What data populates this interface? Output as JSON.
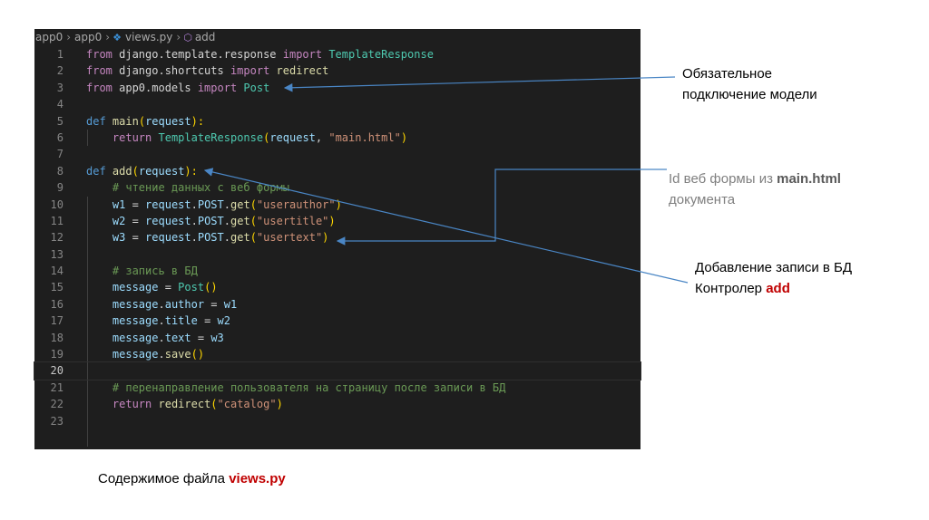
{
  "breadcrumb": {
    "items": [
      "app0",
      "app0",
      "views.py",
      "add"
    ],
    "icons": {
      "file": "python-file-icon",
      "symbol": "cube-method-icon"
    }
  },
  "code": {
    "active_line": 20,
    "lines": [
      {
        "n": "1"
      },
      {
        "n": "2"
      },
      {
        "n": "3"
      },
      {
        "n": "4"
      },
      {
        "n": "5"
      },
      {
        "n": "6"
      },
      {
        "n": "7"
      },
      {
        "n": "8"
      },
      {
        "n": "9"
      },
      {
        "n": "10"
      },
      {
        "n": "11"
      },
      {
        "n": "12"
      },
      {
        "n": "13"
      },
      {
        "n": "14"
      },
      {
        "n": "15"
      },
      {
        "n": "16"
      },
      {
        "n": "17"
      },
      {
        "n": "18"
      },
      {
        "n": "19"
      },
      {
        "n": "20"
      },
      {
        "n": "21"
      },
      {
        "n": "22"
      },
      {
        "n": "23"
      }
    ],
    "tokens": {
      "l1": [
        "from",
        " django.template.response ",
        "import",
        " TemplateResponse"
      ],
      "l2": [
        "from",
        " django.shortcuts ",
        "import",
        " redirect"
      ],
      "l3": [
        "from",
        " app0.models ",
        "import",
        " Post"
      ],
      "l5": [
        "def",
        " ",
        "main",
        "(",
        "request",
        "):"
      ],
      "l6": [
        "return",
        " ",
        "TemplateResponse",
        "(",
        "request",
        ", ",
        "\"main.html\"",
        ")"
      ],
      "l8": [
        "def",
        " ",
        "add",
        "(",
        "request",
        "):"
      ],
      "l9": "# чтение данных с веб формы",
      "l10": [
        "w1",
        " = ",
        "request",
        ".",
        "POST",
        ".",
        "get",
        "(",
        "\"userauthor\"",
        ")"
      ],
      "l11": [
        "w2",
        " = ",
        "request",
        ".",
        "POST",
        ".",
        "get",
        "(",
        "\"usertitle\"",
        ")"
      ],
      "l12": [
        "w3",
        " = ",
        "request",
        ".",
        "POST",
        ".",
        "get",
        "(",
        "\"usertext\"",
        ")"
      ],
      "l14": "# запись в БД",
      "l15": [
        "message",
        " = ",
        "Post",
        "(",
        ")"
      ],
      "l16": [
        "message",
        ".",
        "author",
        " = ",
        "w1"
      ],
      "l17": [
        "message",
        ".",
        "title",
        " = ",
        "w2"
      ],
      "l18": [
        "message",
        ".",
        "text",
        " = ",
        "w3"
      ],
      "l19": [
        "message",
        ".",
        "save",
        "(",
        ")"
      ],
      "l21": "# перенаправление пользователя на страницу после записи в БД",
      "l22": [
        "return",
        " ",
        "redirect",
        "(",
        "\"catalog\"",
        ")"
      ]
    }
  },
  "annotations": {
    "model": {
      "line1": "Обязательное",
      "line2": "подключение модели"
    },
    "form_ids": {
      "pre": "Id веб формы из ",
      "bold": "main.html",
      "line2": "документа"
    },
    "controller": {
      "line1": "Добавление записи в БД",
      "pre2": "Контролер ",
      "bold": "add"
    }
  },
  "caption": {
    "pre": "Содержимое файла ",
    "bold": "views.py"
  },
  "colors": {
    "editor_bg": "#1e1e1e",
    "arrow": "#4a86c5",
    "accent_red": "#c00000"
  }
}
